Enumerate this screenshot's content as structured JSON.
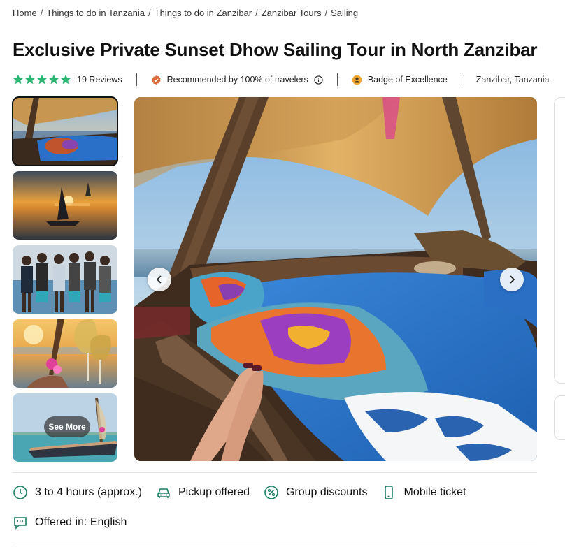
{
  "breadcrumb": [
    "Home",
    "Things to do in Tanzania",
    "Things to do in Zanzibar",
    "Zanzibar Tours",
    "Sailing"
  ],
  "title": "Exclusive Private Sunset Dhow Sailing Tour in North Zanzibar",
  "rating": {
    "stars": 5,
    "reviews_label": "19 Reviews",
    "star_color": "#2bb673"
  },
  "meta": {
    "recommended": "Recommended by 100% of travelers",
    "badge": "Badge of Excellence",
    "location": "Zanzibar, Tanzania"
  },
  "gallery": {
    "see_more_label": "See More",
    "thumbnails": [
      "sunset-deck",
      "sunset-sailboat",
      "crew-group",
      "wine-glasses",
      "dhow-boat"
    ]
  },
  "features": {
    "duration": "3 to 4 hours (approx.)",
    "pickup": "Pickup offered",
    "discounts": "Group discounts",
    "ticket": "Mobile ticket",
    "language": "Offered in: English"
  },
  "colors": {
    "accent": "#1a7f64",
    "text": "#1a1a1a"
  }
}
